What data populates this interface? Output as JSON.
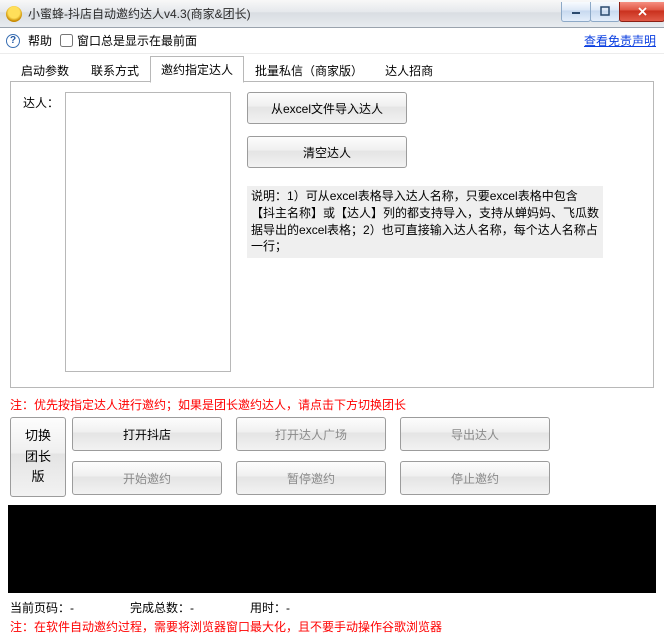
{
  "window": {
    "title": "小蜜蜂-抖店自动邀约达人v4.3(商家&团长)"
  },
  "toolbar": {
    "help_label": "帮助",
    "always_on_top_label": "窗口总是显示在最前面",
    "disclaimer_link": "查看免责声明"
  },
  "tabs": {
    "items": [
      {
        "id": "startup",
        "label": "启动参数"
      },
      {
        "id": "contact",
        "label": "联系方式"
      },
      {
        "id": "invite",
        "label": "邀约指定达人",
        "active": true
      },
      {
        "id": "batchpm",
        "label": "批量私信（商家版）"
      },
      {
        "id": "recruit",
        "label": "达人招商"
      }
    ]
  },
  "invite": {
    "daren_label": "达人：",
    "textarea_value": "",
    "import_btn": "从excel文件导入达人",
    "clear_btn": "清空达人",
    "desc": "说明：1）可从excel表格导入达人名称，只要excel表格中包含【抖主名称】或【达人】列的都支持导入，支持从蝉妈妈、飞瓜数据导出的excel表格；2）也可直接输入达人名称，每个达人名称占一行；"
  },
  "note1": "注：优先按指定达人进行邀约；如果是团长邀约达人，请点击下方切换团长",
  "switch_btn": "切换团长版",
  "actions": {
    "open_shop": "打开抖店",
    "open_plaza": "打开达人广场",
    "export": "导出达人",
    "start": "开始邀约",
    "pause": "暂停邀约",
    "stop": "停止邀约"
  },
  "status": {
    "page_label": "当前页码：",
    "page_value": "-",
    "done_label": "完成总数：",
    "done_value": "-",
    "time_label": "用时：",
    "time_value": "-"
  },
  "note2": "注：在软件自动邀约过程，需要将浏览器窗口最大化，且不要手动操作谷歌浏览器"
}
